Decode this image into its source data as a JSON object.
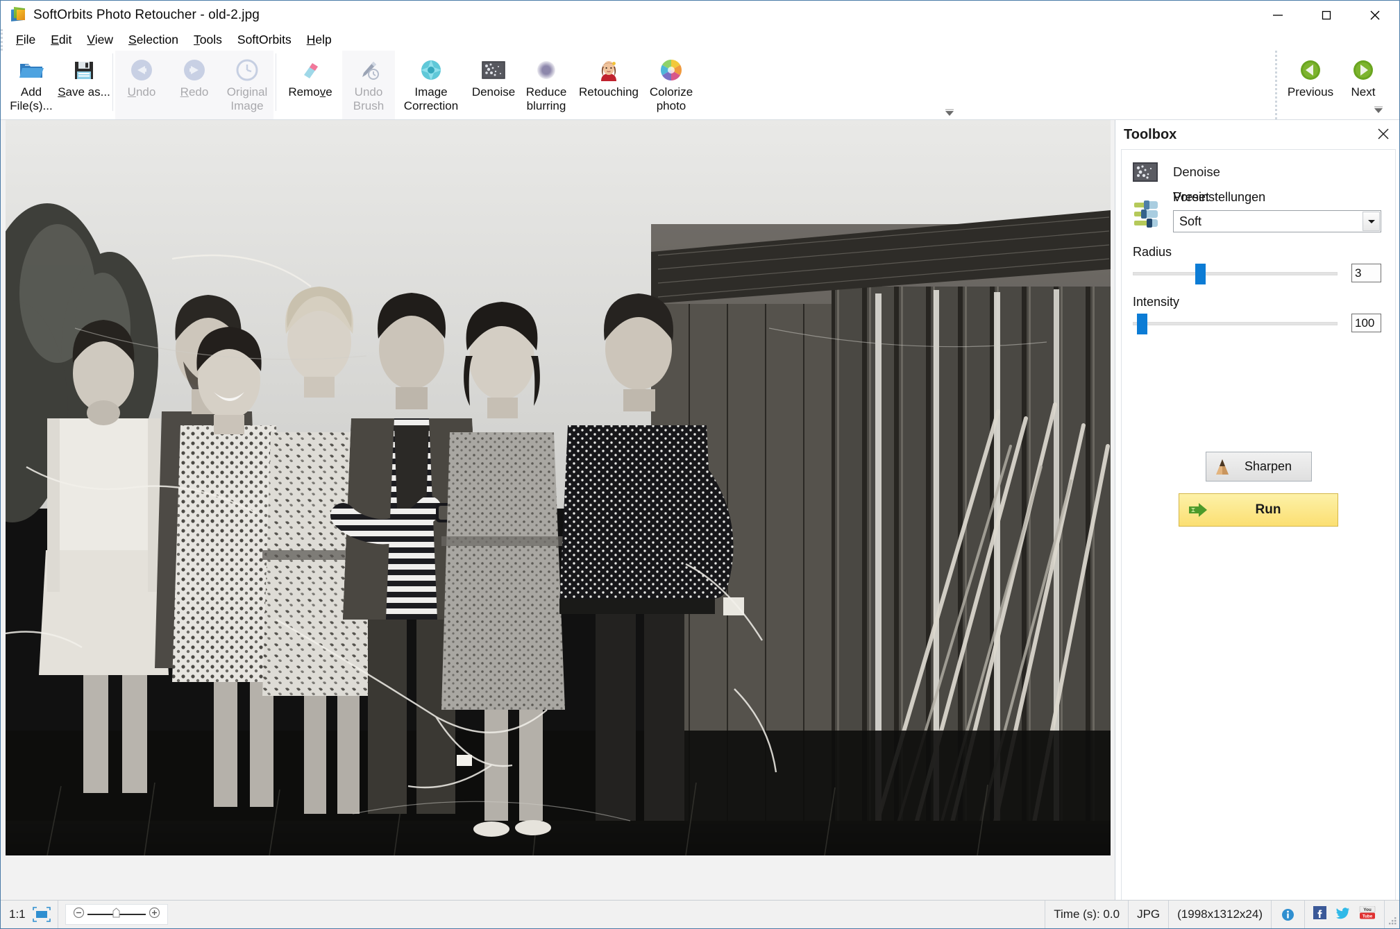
{
  "window": {
    "title": "SoftOrbits Photo Retoucher - old-2.jpg",
    "app_icon": "softorbits-logo-icon",
    "minimize": "minimize-icon",
    "maximize": "maximize-icon",
    "close": "close-icon"
  },
  "menubar": {
    "items": [
      {
        "label": "File",
        "accel": "F"
      },
      {
        "label": "Edit",
        "accel": "E"
      },
      {
        "label": "View",
        "accel": "V"
      },
      {
        "label": "Selection",
        "accel": "S"
      },
      {
        "label": "Tools",
        "accel": "T"
      },
      {
        "label": "SoftOrbits",
        "accel": ""
      },
      {
        "label": "Help",
        "accel": "H"
      }
    ]
  },
  "ribbon": {
    "buttons": [
      {
        "label": "Add File(s)...",
        "icon": "open-folder-icon",
        "disabled": false
      },
      {
        "label": "Save as...",
        "icon": "floppy-save-icon",
        "disabled": false
      },
      {
        "label": "Undo",
        "icon": "undo-arrow-icon",
        "disabled": true
      },
      {
        "label": "Redo",
        "icon": "redo-arrow-icon",
        "disabled": true
      },
      {
        "label": "Original Image",
        "icon": "clock-history-icon",
        "disabled": true
      },
      {
        "label": "Remove",
        "icon": "eraser-icon",
        "disabled": false
      },
      {
        "label": "Undo Brush",
        "icon": "brush-undo-icon",
        "disabled": true
      },
      {
        "label": "Image Correction",
        "icon": "color-gem-icon",
        "disabled": false
      },
      {
        "label": "Denoise",
        "icon": "noise-swatch-icon",
        "disabled": false
      },
      {
        "label": "Reduce blurring",
        "icon": "blur-circle-icon",
        "disabled": false
      },
      {
        "label": "Retouching",
        "icon": "portrait-face-icon",
        "disabled": false
      },
      {
        "label": "Colorize photo",
        "icon": "color-wheel-icon",
        "disabled": false
      }
    ],
    "navigation": [
      {
        "label": "Previous",
        "icon": "green-left-arrow-icon"
      },
      {
        "label": "Next",
        "icon": "green-right-arrow-icon"
      }
    ],
    "expand_icon": "ribbon-expand-icon"
  },
  "toolbox": {
    "title": "Toolbox",
    "close_icon": "close-icon",
    "tool": {
      "name": "Denoise",
      "icon": "noise-swatch-icon"
    },
    "preset": {
      "icon": "sliders-preset-icon",
      "label_en": "Preset",
      "label_de": "Voreinstellungen",
      "value": "Soft",
      "dropdown_icon": "chevron-down-icon"
    },
    "sliders": [
      {
        "label": "Radius",
        "value": "3",
        "percent": 30,
        "min": 0,
        "max": 10
      },
      {
        "label": "Intensity",
        "value": "100",
        "percent": 2,
        "min": 0,
        "max": 100
      }
    ],
    "sharpen_button": {
      "label": "Sharpen",
      "icon": "sharpen-cone-icon"
    },
    "run_button": {
      "label": "Run",
      "icon": "green-run-arrow-icon"
    }
  },
  "canvas": {
    "photo_alt": "Black and white vintage group photograph of seven people standing in front of a wooden barn with leaning poles"
  },
  "statusbar": {
    "zoom_ratio": "1:1",
    "fit_icon": "fit-to-window-icon",
    "zoom_out_icon": "zoom-out-icon",
    "zoom_in_icon": "zoom-in-icon",
    "zoom_handle_icon": "zoom-slider-handle-icon",
    "time": "Time (s): 0.0",
    "format": "JPG",
    "dimensions": "(1998x1312x24)",
    "info_icon": "info-icon",
    "facebook_icon": "facebook-icon",
    "twitter_icon": "twitter-icon",
    "youtube_icon": "youtube-icon",
    "resize_grip_icon": "resize-grip-icon"
  },
  "colors": {
    "accent_blue": "#0c7cd5",
    "run_yellow": "#fbdf72",
    "window_border": "#4a7ba7",
    "green_nav": "#5d9a20"
  }
}
